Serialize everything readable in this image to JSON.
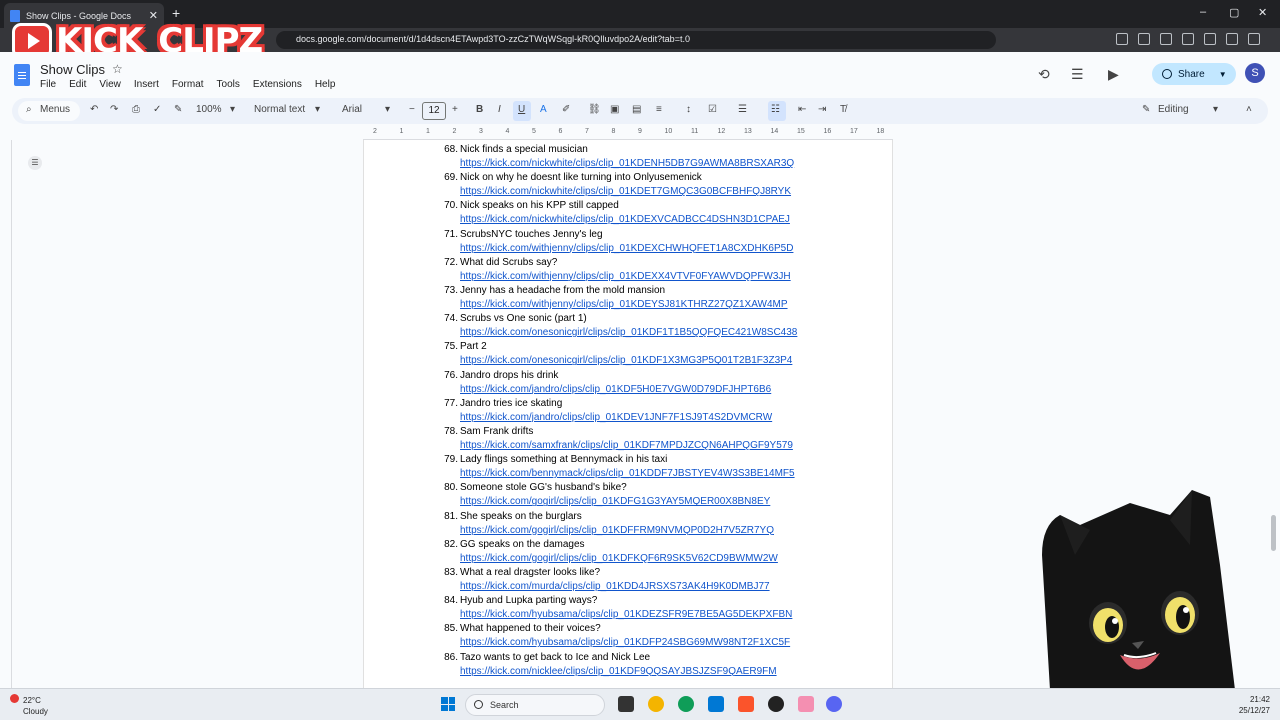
{
  "browser": {
    "tab_title": "Show Clips - Google Docs",
    "new_tab": "+",
    "url": "docs.google.com/document/d/1d4dscn4ETAwpd3TO-zzCzTWqWSqgl-kR0QIluvdpo2A/edit?tab=t.0",
    "window_controls": [
      "–",
      "▢",
      "✕"
    ]
  },
  "overlay_logo": {
    "text": "KICK_CLIPZ"
  },
  "docs": {
    "title": "Show Clips",
    "menu": [
      "File",
      "Edit",
      "View",
      "Insert",
      "Format",
      "Tools",
      "Extensions",
      "Help"
    ],
    "share_label": "Share",
    "avatar_initial": "S"
  },
  "toolbar": {
    "menus_label": "Menus",
    "zoom": "100%",
    "style": "Normal text",
    "font": "Arial",
    "font_size": "12",
    "mode": "Editing"
  },
  "ruler": [
    "2",
    "1",
    "1",
    "2",
    "3",
    "4",
    "5",
    "6",
    "7",
    "8",
    "9",
    "10",
    "11",
    "12",
    "13",
    "14",
    "15",
    "16",
    "17",
    "18"
  ],
  "clips": [
    {
      "num": "68.",
      "title": "Nick finds a special musician",
      "link": "https://kick.com/nickwhite/clips/clip_01KDENH5DB7G9AWMA8BRSXAR3Q"
    },
    {
      "num": "69.",
      "title": "Nick on why he doesnt like turning into Onlyusemenick",
      "link": "https://kick.com/nickwhite/clips/clip_01KDET7GMQC3G0BCFBHFQJ8RYK"
    },
    {
      "num": "70.",
      "title": "Nick speaks on his KPP still capped",
      "link": "https://kick.com/nickwhite/clips/clip_01KDEXVCADBCC4DSHN3D1CPAEJ"
    },
    {
      "num": "71.",
      "title": "ScrubsNYC touches Jenny's leg",
      "link": "https://kick.com/withjenny/clips/clip_01KDEXCHWHQFET1A8CXDHK6P5D"
    },
    {
      "num": "72.",
      "title": "What did Scrubs say?",
      "link": "https://kick.com/withjenny/clips/clip_01KDEXX4VTVF0FYAWVDQPFW3JH"
    },
    {
      "num": "73.",
      "title": "Jenny has a headache from the mold mansion",
      "link": "https://kick.com/withjenny/clips/clip_01KDEYSJ81KTHRZ27QZ1XAW4MP"
    },
    {
      "num": "74.",
      "title": "Scrubs vs One sonic (part 1)",
      "link": "https://kick.com/onesonicgirl/clips/clip_01KDF1T1B5QQFQEC421W8SC438"
    },
    {
      "num": "75.",
      "title": "Part 2",
      "link": "https://kick.com/onesonicgirl/clips/clip_01KDF1X3MG3P5Q01T2B1F3Z3P4"
    },
    {
      "num": "76.",
      "title": "Jandro drops his drink",
      "link": "https://kick.com/jandro/clips/clip_01KDF5H0E7VGW0D79DFJHPT6B6"
    },
    {
      "num": "77.",
      "title": "Jandro tries ice skating",
      "link": "https://kick.com/jandro/clips/clip_01KDEV1JNF7F1SJ9T4S2DVMCRW"
    },
    {
      "num": "78.",
      "title": "Sam Frank drifts",
      "link": "https://kick.com/samxfrank/clips/clip_01KDF7MPDJZCQN6AHPQGF9Y579"
    },
    {
      "num": "79.",
      "title": "Lady flings something at Bennymack in his taxi",
      "link": "https://kick.com/bennymack/clips/clip_01KDDF7JBSTYEV4W3S3BE14MF5"
    },
    {
      "num": "80.",
      "title": "Someone stole GG's husband's bike?",
      "link": "https://kick.com/gogirl/clips/clip_01KDFG1G3YAY5MQER00X8BN8EY"
    },
    {
      "num": "81.",
      "title": "She speaks on the burglars",
      "link": "https://kick.com/gogirl/clips/clip_01KDFFRM9NVMQP0D2H7V5ZR7YQ"
    },
    {
      "num": "82.",
      "title": "GG speaks on the damages",
      "link": "https://kick.com/gogirl/clips/clip_01KDFKQF6R9SK5V62CD9BWMW2W"
    },
    {
      "num": "83.",
      "title": "What a real dragster looks like?",
      "link": "https://kick.com/murda/clips/clip_01KDD4JRSXS73AK4H9K0DMBJ77"
    },
    {
      "num": "84.",
      "title": "Hyub and Lupka parting ways?",
      "link": "https://kick.com/hyubsama/clips/clip_01KDEZSFR9E7BE5AG5DEKPXFBN"
    },
    {
      "num": "85.",
      "title": "What happened to their voices?",
      "link": "https://kick.com/hyubsama/clips/clip_01KDFP24SBG69MW98NT2F1XC5F"
    },
    {
      "num": "86.",
      "title": "Tazo wants to get back to Ice and Nick Lee",
      "link": "https://kick.com/nicklee/clips/clip_01KDF9QQSAYJBSJZSF9QAER9FM"
    }
  ],
  "taskbar": {
    "temperature": "22°C",
    "weather": "Cloudy",
    "search_label": "Search",
    "time": "21:42",
    "date": "25/12/27"
  },
  "colors": {
    "link": "#1155cc",
    "share_bg": "#c2e7ff",
    "toolbar_bg": "#edf2fa",
    "logo_red": "#e53935"
  }
}
